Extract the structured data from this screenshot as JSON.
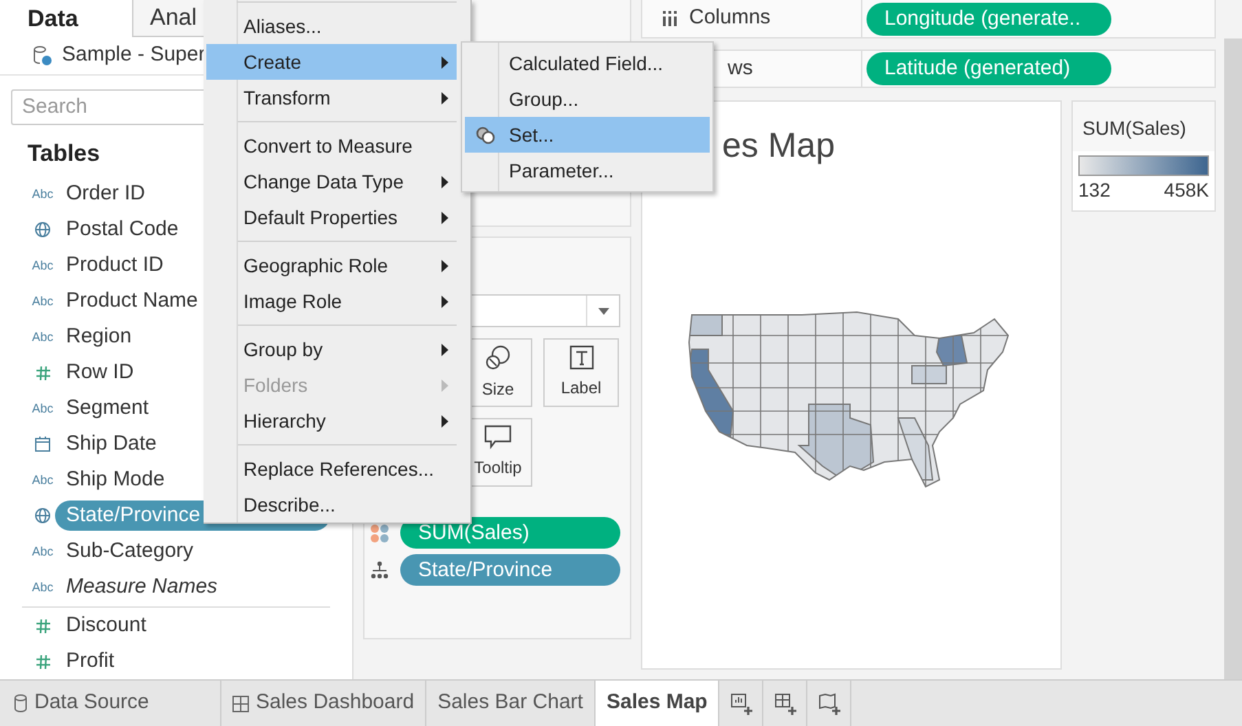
{
  "sidebar": {
    "tabs": [
      {
        "label": "Data",
        "selected": true
      },
      {
        "label": "Anal",
        "selected": false
      }
    ],
    "datasource": "Sample - Super",
    "search": {
      "placeholder": "Search"
    },
    "section": "Tables",
    "fields": [
      {
        "kind": "text",
        "type_label": "Abc",
        "name": "Order ID",
        "selected": false,
        "italic": false
      },
      {
        "kind": "geo",
        "name": "Postal Code",
        "selected": false,
        "italic": false
      },
      {
        "kind": "text",
        "type_label": "Abc",
        "name": "Product ID",
        "selected": false,
        "italic": false
      },
      {
        "kind": "text",
        "type_label": "Abc",
        "name": "Product Name",
        "selected": false,
        "italic": false
      },
      {
        "kind": "text",
        "type_label": "Abc",
        "name": "Region",
        "selected": false,
        "italic": false
      },
      {
        "kind": "number",
        "name": "Row ID",
        "selected": false,
        "italic": false
      },
      {
        "kind": "text",
        "type_label": "Abc",
        "name": "Segment",
        "selected": false,
        "italic": false
      },
      {
        "kind": "date",
        "name": "Ship Date",
        "selected": false,
        "italic": false
      },
      {
        "kind": "text",
        "type_label": "Abc",
        "name": "Ship Mode",
        "selected": false,
        "italic": false
      },
      {
        "kind": "geo",
        "name": "State/Province",
        "selected": true,
        "italic": false
      },
      {
        "kind": "text",
        "type_label": "Abc",
        "name": "Sub-Category",
        "selected": false,
        "italic": false
      },
      {
        "kind": "text",
        "type_label": "Abc",
        "name": "Measure Names",
        "selected": false,
        "italic": true
      }
    ],
    "measures": [
      {
        "kind": "number",
        "name": "Discount"
      },
      {
        "kind": "number",
        "name": "Profit"
      }
    ]
  },
  "shelves": [
    {
      "kind": "columns",
      "label": "Columns",
      "pill": "Longitude (generate..",
      "color": "#00b180"
    },
    {
      "kind": "rows",
      "label": "ws",
      "pill": "Latitude (generated)",
      "color": "#00b180"
    }
  ],
  "marks": {
    "buttons": [
      {
        "kind": "size",
        "label": "Size"
      },
      {
        "kind": "label",
        "label": "Label"
      },
      {
        "kind": "tooltip",
        "label": "Tooltip"
      }
    ],
    "pills": [
      {
        "kind": "color",
        "label": "SUM(Sales)",
        "color": "#00b180"
      },
      {
        "kind": "detail",
        "label": "State/Province",
        "color": "#4996b2"
      }
    ]
  },
  "view": {
    "title": "es Map"
  },
  "legend": {
    "title": "SUM(Sales)",
    "min": "132",
    "max": "458K"
  },
  "context_menu": [
    {
      "kind": "item",
      "label": "Aliases...",
      "submenu": false,
      "selected": false,
      "disabled": false
    },
    {
      "kind": "item",
      "label": "Create",
      "submenu": true,
      "selected": true,
      "disabled": false
    },
    {
      "kind": "item",
      "label": "Transform",
      "submenu": true,
      "selected": false,
      "disabled": false
    },
    {
      "kind": "separator"
    },
    {
      "kind": "item",
      "label": "Convert to Measure",
      "submenu": false,
      "selected": false,
      "disabled": false
    },
    {
      "kind": "item",
      "label": "Change Data Type",
      "submenu": true,
      "selected": false,
      "disabled": false
    },
    {
      "kind": "item",
      "label": "Default Properties",
      "submenu": true,
      "selected": false,
      "disabled": false
    },
    {
      "kind": "separator"
    },
    {
      "kind": "item",
      "label": "Geographic Role",
      "submenu": true,
      "selected": false,
      "disabled": false
    },
    {
      "kind": "item",
      "label": "Image Role",
      "submenu": true,
      "selected": false,
      "disabled": false
    },
    {
      "kind": "separator"
    },
    {
      "kind": "item",
      "label": "Group by",
      "submenu": true,
      "selected": false,
      "disabled": false
    },
    {
      "kind": "item",
      "label": "Folders",
      "submenu": true,
      "selected": false,
      "disabled": true
    },
    {
      "kind": "item",
      "label": "Hierarchy",
      "submenu": true,
      "selected": false,
      "disabled": false
    },
    {
      "kind": "separator"
    },
    {
      "kind": "item",
      "label": "Replace References...",
      "submenu": false,
      "selected": false,
      "disabled": false
    },
    {
      "kind": "item",
      "label": "Describe...",
      "submenu": false,
      "selected": false,
      "disabled": false
    }
  ],
  "submenu": [
    {
      "kind": "plain",
      "label": "Calculated Field...",
      "selected": false
    },
    {
      "kind": "plain",
      "label": "Group...",
      "selected": false
    },
    {
      "kind": "set",
      "label": "Set...",
      "selected": true
    },
    {
      "kind": "plain",
      "label": "Parameter...",
      "selected": false
    }
  ],
  "sheet_tabs": [
    {
      "kind": "source",
      "label": "Data Source",
      "selected": false
    },
    {
      "kind": "dashboard",
      "label": "Sales Dashboard",
      "selected": false
    },
    {
      "kind": "sheet",
      "label": "Sales Bar Chart",
      "selected": false
    },
    {
      "kind": "sheet",
      "label": "Sales Map",
      "selected": true
    }
  ]
}
